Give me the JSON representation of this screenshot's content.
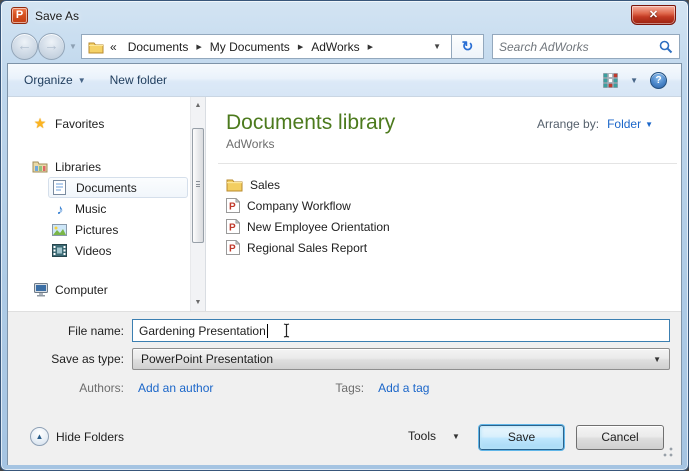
{
  "window": {
    "title": "Save As",
    "app_icon_letter": "P"
  },
  "icons": {
    "close": "✕",
    "back_arrow": "←",
    "forward_arrow": "→",
    "nav_history_dropdown": "▼",
    "breadcrumb_collapsed": "«",
    "crumb_separator": "▶",
    "breadcrumb_dropdown": "▼",
    "refresh": "↻",
    "menu_dropdown": "▼",
    "help": "?",
    "star": "★",
    "music_note": "♪",
    "scroll_up": "▲",
    "scroll_down": "▼",
    "combo_dropdown": "▼",
    "hide_folders_arrow": "▲"
  },
  "nav": {
    "breadcrumb": {
      "segments": [
        "Documents",
        "My Documents",
        "AdWorks"
      ]
    },
    "search": {
      "placeholder": "Search AdWorks"
    }
  },
  "toolbar": {
    "organize_label": "Organize",
    "new_folder_label": "New folder"
  },
  "sidebar": {
    "items": [
      {
        "label": "Favorites"
      },
      {
        "label": "Libraries"
      },
      {
        "label": "Documents",
        "selected": true
      },
      {
        "label": "Music"
      },
      {
        "label": "Pictures"
      },
      {
        "label": "Videos"
      },
      {
        "label": "Computer"
      }
    ]
  },
  "main": {
    "library_title": "Documents library",
    "library_subtitle": "AdWorks",
    "arrange_by_label": "Arrange by:",
    "arrange_by_value": "Folder",
    "files": [
      {
        "name": "Sales",
        "type": "folder"
      },
      {
        "name": "Company Workflow",
        "type": "powerpoint"
      },
      {
        "name": "New Employee Orientation",
        "type": "powerpoint"
      },
      {
        "name": "Regional Sales Report",
        "type": "powerpoint"
      }
    ]
  },
  "form": {
    "file_name_label": "File name:",
    "file_name_value": "Gardening Presentation",
    "save_as_type_label": "Save as type:",
    "save_as_type_value": "PowerPoint Presentation",
    "authors_label": "Authors:",
    "authors_link": "Add an author",
    "tags_label": "Tags:",
    "tags_link": "Add a tag"
  },
  "footer": {
    "hide_folders_label": "Hide Folders",
    "tools_label": "Tools",
    "save_label": "Save",
    "cancel_label": "Cancel"
  },
  "colors": {
    "library_title_green": "#4c7a1d",
    "link_blue": "#1b66c9",
    "toolbar_text_blue": "#1e3c5c",
    "aero_glass_blue": "#bed6ec",
    "default_button_glow": "#60b6e8",
    "close_button_red": "#c33b24"
  }
}
